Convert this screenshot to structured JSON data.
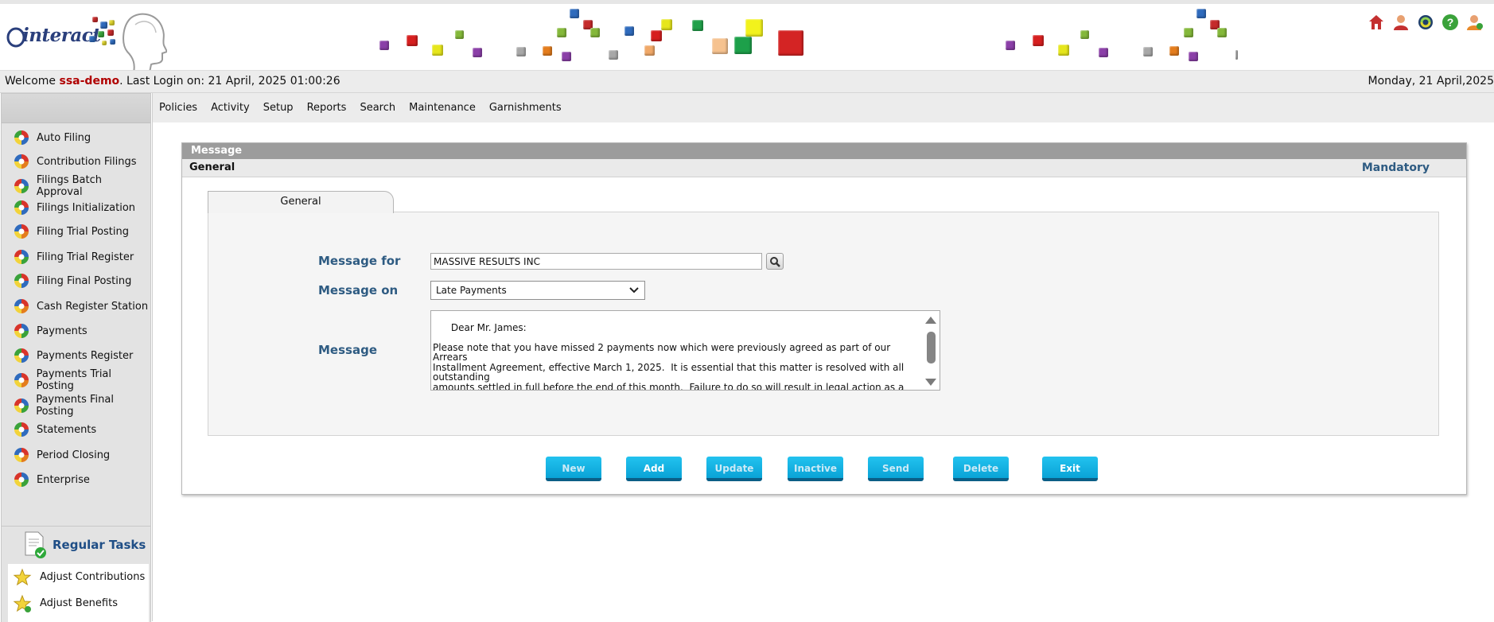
{
  "header": {
    "brand": "interact",
    "icons": [
      "home-icon",
      "user-admin-icon",
      "refresh-icon",
      "help-icon",
      "user-logout-icon"
    ]
  },
  "welcome": {
    "prefix": "Welcome ",
    "user": "ssa-demo",
    "last_login": ". Last Login on: 21 April, 2025 01:00:26",
    "date": "Monday, 21 April,2025"
  },
  "menu": {
    "items": [
      "Policies",
      "Activity",
      "Setup",
      "Reports",
      "Search",
      "Maintenance",
      "Garnishments"
    ]
  },
  "sidebar": {
    "items": [
      {
        "label": "Auto Filing",
        "icon": "star-icon"
      },
      {
        "label": "Contribution Filings",
        "icon": "puzzle-icon"
      },
      {
        "label": "Filings Batch Approval",
        "icon": "globe-icon"
      },
      {
        "label": "Filings Initialization",
        "icon": "ring-icon"
      },
      {
        "label": "Filing Trial Posting",
        "icon": "swirl-icon"
      },
      {
        "label": "Filing Trial Register",
        "icon": "flask-icon"
      },
      {
        "label": "Filing Final Posting",
        "icon": "pinwheel-icon"
      },
      {
        "label": "Cash Register Station",
        "icon": "ring-icon"
      },
      {
        "label": "Payments",
        "icon": "balls-icon"
      },
      {
        "label": "Payments Register",
        "icon": "ring-icon"
      },
      {
        "label": "Payments Trial Posting",
        "icon": "flower-icon"
      },
      {
        "label": "Payments Final Posting",
        "icon": "swirl-icon"
      },
      {
        "label": "Statements",
        "icon": "spheres-icon"
      },
      {
        "label": "Period Closing",
        "icon": "swirl-icon"
      },
      {
        "label": "Enterprise",
        "icon": "cross-icon"
      }
    ],
    "regular_tasks_label": "Regular Tasks",
    "regular_tasks": [
      {
        "label": "Adjust Contributions",
        "icon": "star-icon"
      },
      {
        "label": "Adjust Benefits",
        "icon": "star-plus-icon"
      }
    ]
  },
  "panel": {
    "title": "Message",
    "section": "General",
    "mandatory": "Mandatory",
    "tab": "General",
    "fields": {
      "message_for_label": "Message for",
      "message_for_value": "MASSIVE RESULTS INC",
      "message_on_label": "Message on",
      "message_on_value": "Late Payments",
      "message_label": "Message",
      "message_value": "Dear Mr. James:\n\nPlease note that you have missed 2 payments now which were previously agreed as part of our Arrears\nInstallment Agreement, effective March 1, 2025.  It is essential that this matter is resolved with all outstanding\namounts settled in full before the end of this month.  Failure to do so will result in legal action as a last resort."
    },
    "buttons": {
      "new": "New",
      "add": "Add",
      "update": "Update",
      "inactive": "Inactive",
      "send": "Send",
      "delete": "Delete",
      "exit": "Exit"
    }
  }
}
